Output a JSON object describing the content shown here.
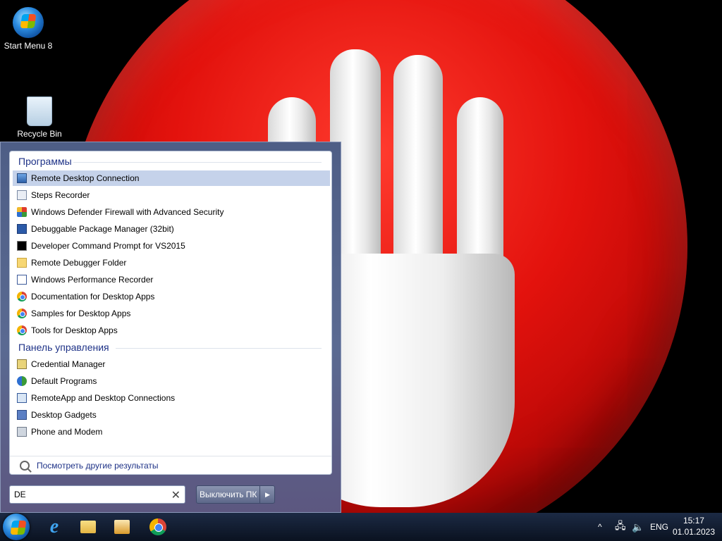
{
  "desktop": {
    "icons": [
      {
        "label": "Start Menu 8",
        "icon": "windows-orb-icon"
      },
      {
        "label": "Recycle Bin",
        "icon": "recycle-bin-icon"
      }
    ]
  },
  "start_menu": {
    "programs_header": "Программы",
    "programs": [
      {
        "label": "Remote Desktop Connection",
        "icon": "remote-desktop-icon",
        "selected": true
      },
      {
        "label": "Steps Recorder",
        "icon": "steps-recorder-icon"
      },
      {
        "label": "Windows Defender Firewall with Advanced Security",
        "icon": "firewall-icon"
      },
      {
        "label": "Debuggable Package Manager (32bit)",
        "icon": "powershell-icon"
      },
      {
        "label": "Developer Command Prompt for VS2015",
        "icon": "command-prompt-icon"
      },
      {
        "label": "Remote Debugger Folder",
        "icon": "folder-icon"
      },
      {
        "label": "Windows Performance Recorder",
        "icon": "performance-recorder-icon"
      },
      {
        "label": "Documentation for Desktop Apps",
        "icon": "chrome-icon"
      },
      {
        "label": "Samples for Desktop Apps",
        "icon": "chrome-icon"
      },
      {
        "label": "Tools for Desktop Apps",
        "icon": "chrome-icon"
      }
    ],
    "control_panel_header": "Панель управления",
    "control_panel": [
      {
        "label": "Credential Manager",
        "icon": "credential-manager-icon"
      },
      {
        "label": "Default Programs",
        "icon": "default-programs-icon"
      },
      {
        "label": "RemoteApp and Desktop Connections",
        "icon": "remoteapp-icon"
      },
      {
        "label": "Desktop Gadgets",
        "icon": "gadgets-icon"
      },
      {
        "label": "Phone and Modem",
        "icon": "phone-modem-icon"
      }
    ],
    "more_results": "Посмотреть другие результаты",
    "search": {
      "value": "DE",
      "clear_icon": "✕"
    },
    "shutdown_label": "Выключить ПК",
    "shutdown_arrow": "▶"
  },
  "taskbar": {
    "pinned": [
      "start-orb",
      "internet-explorer-icon",
      "file-explorer-icon",
      "media-player-icon",
      "chrome-icon"
    ],
    "tray": {
      "chevron": "^",
      "language": "ENG"
    },
    "clock": {
      "time": "15:17",
      "date": "01.01.2023"
    }
  }
}
